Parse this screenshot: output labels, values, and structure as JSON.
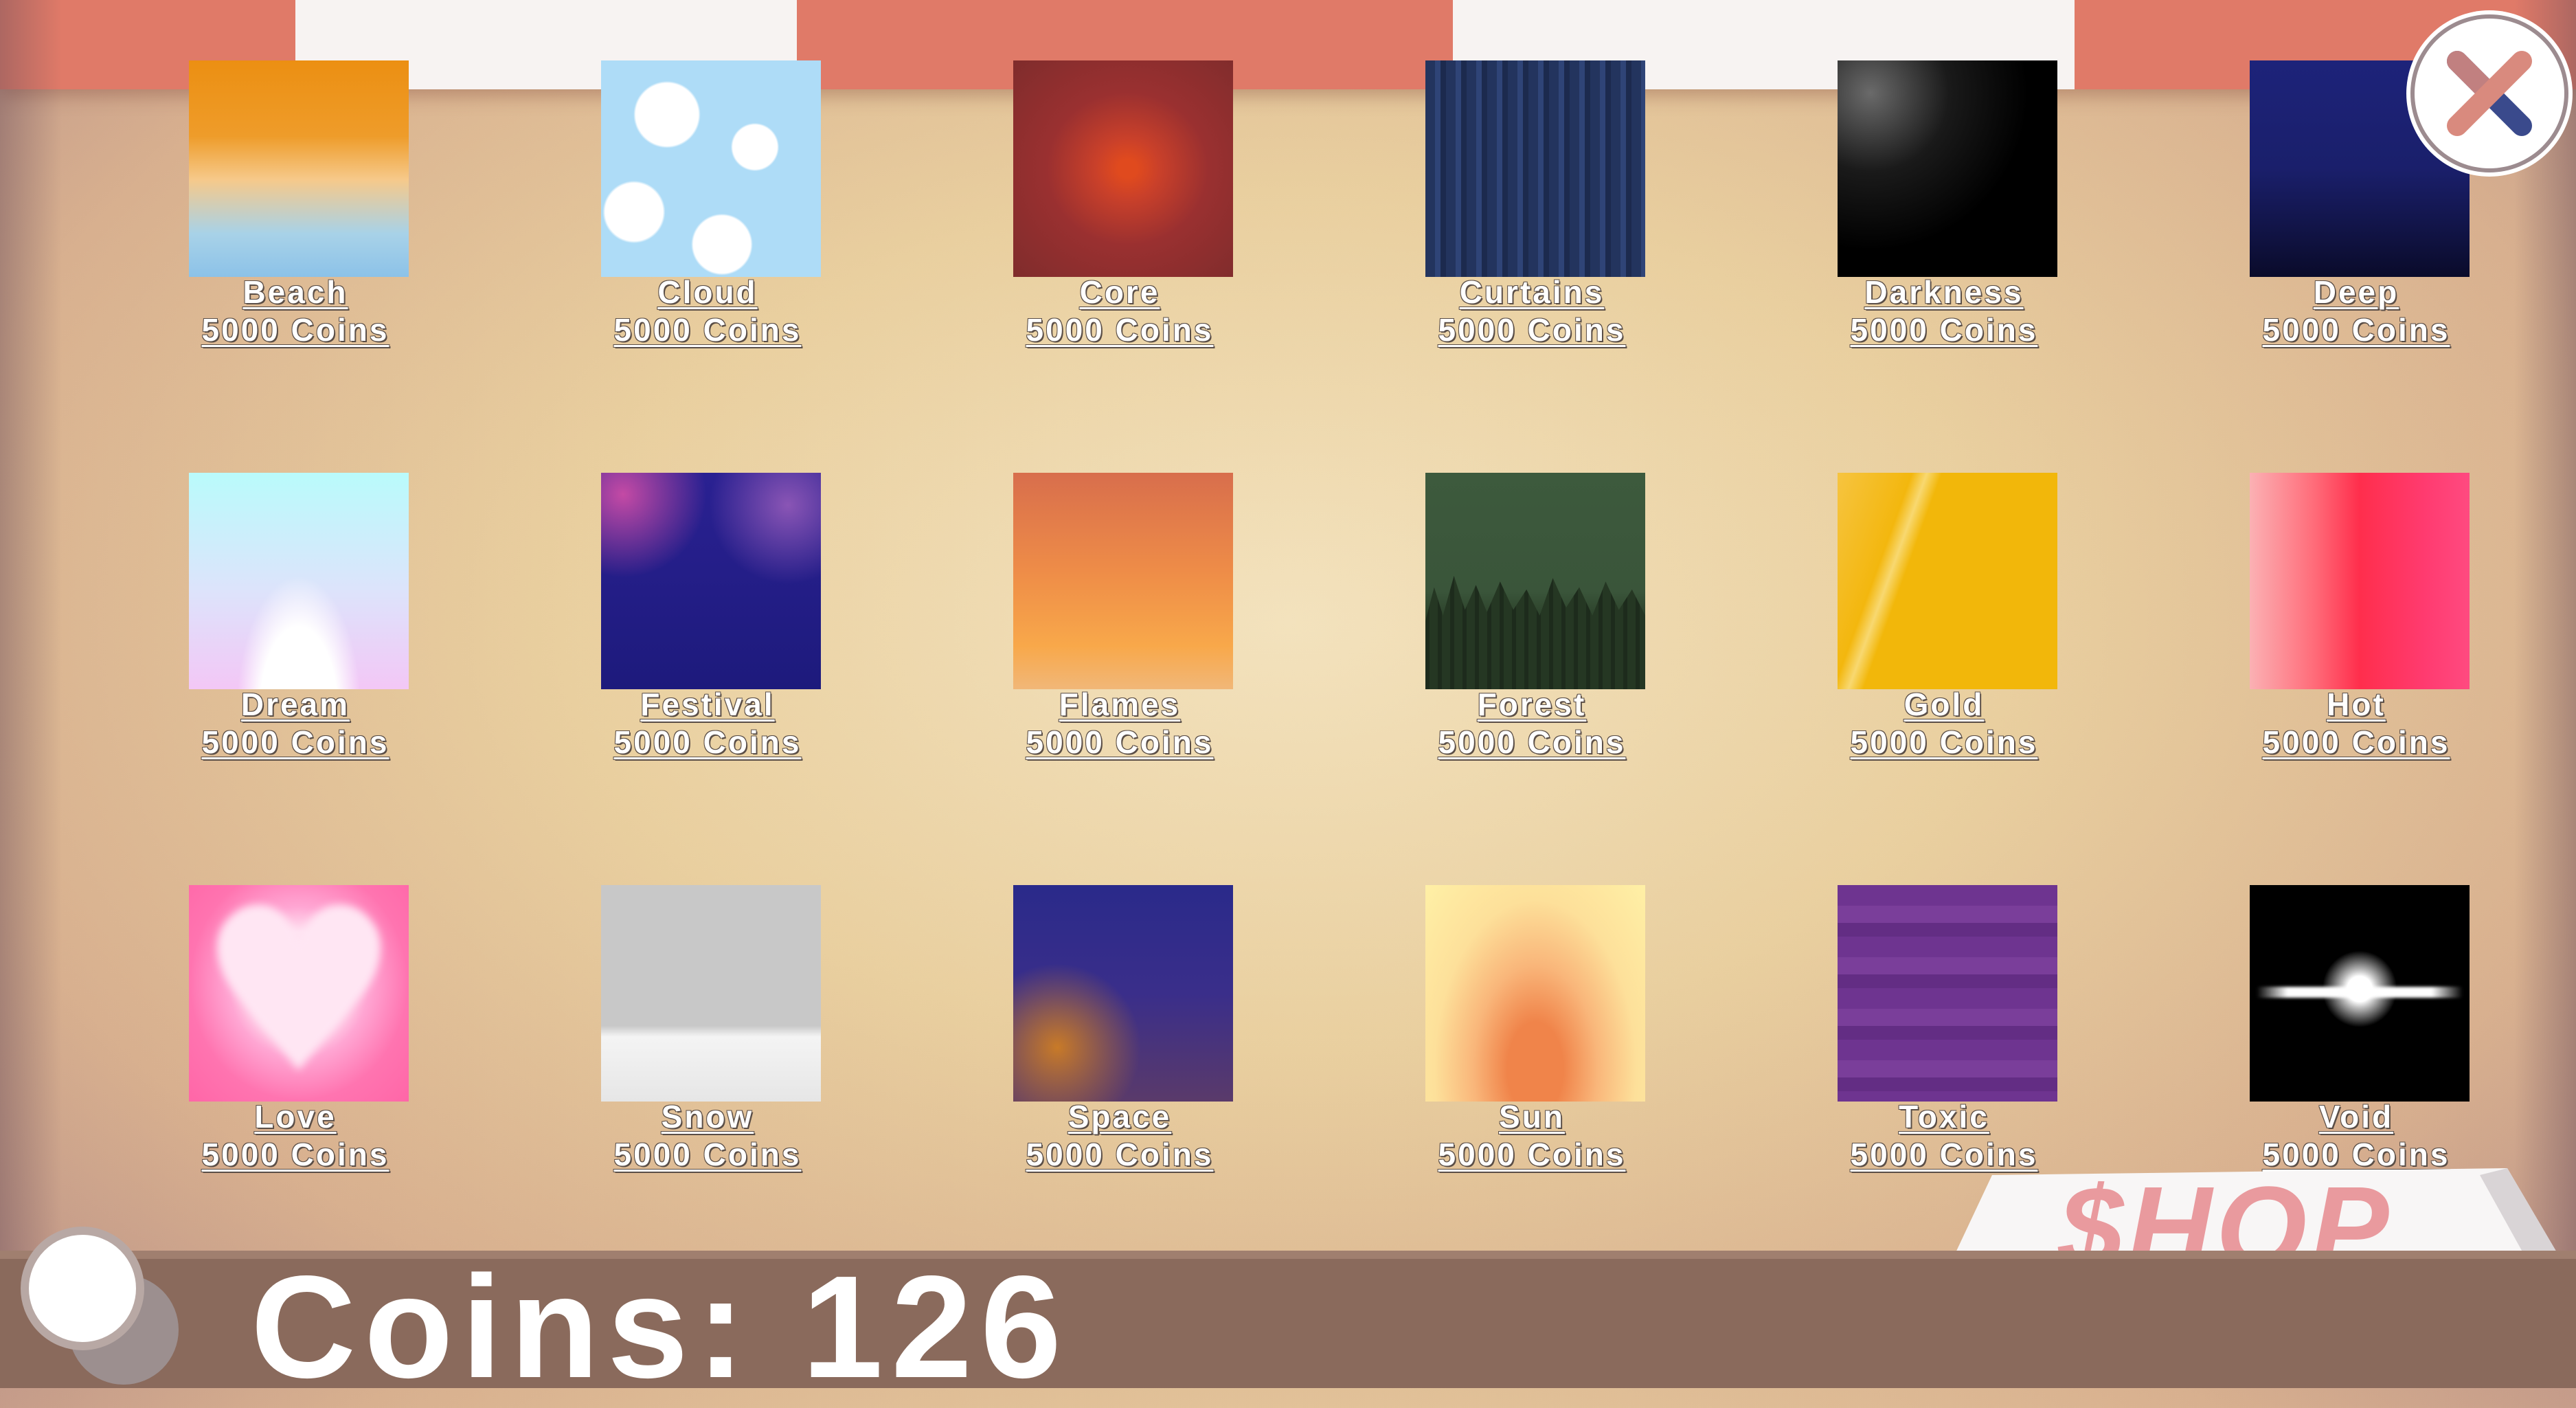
{
  "colors": {
    "awning_red": "#e07a68",
    "awning_white": "#f7f3f2",
    "label_text": "#ffffff",
    "counter_wood": "#8a6a5c",
    "sign_text": "#e99a9e"
  },
  "shop": {
    "items": [
      {
        "name": "Beach",
        "price": "5000 Coins",
        "swatch": "beach"
      },
      {
        "name": "Cloud",
        "price": "5000 Coins",
        "swatch": "cloud"
      },
      {
        "name": "Core",
        "price": "5000 Coins",
        "swatch": "core"
      },
      {
        "name": "Curtains",
        "price": "5000 Coins",
        "swatch": "curtains"
      },
      {
        "name": "Darkness",
        "price": "5000 Coins",
        "swatch": "darkness"
      },
      {
        "name": "Deep",
        "price": "5000 Coins",
        "swatch": "deep"
      },
      {
        "name": "Dream",
        "price": "5000 Coins",
        "swatch": "dream"
      },
      {
        "name": "Festival",
        "price": "5000 Coins",
        "swatch": "festival"
      },
      {
        "name": "Flames",
        "price": "5000 Coins",
        "swatch": "flames"
      },
      {
        "name": "Forest",
        "price": "5000 Coins",
        "swatch": "forest"
      },
      {
        "name": "Gold",
        "price": "5000 Coins",
        "swatch": "gold"
      },
      {
        "name": "Hot",
        "price": "5000 Coins",
        "swatch": "hot"
      },
      {
        "name": "Love",
        "price": "5000 Coins",
        "swatch": "love"
      },
      {
        "name": "Snow",
        "price": "5000 Coins",
        "swatch": "snow"
      },
      {
        "name": "Space",
        "price": "5000 Coins",
        "swatch": "space"
      },
      {
        "name": "Sun",
        "price": "5000 Coins",
        "swatch": "sun"
      },
      {
        "name": "Toxic",
        "price": "5000 Coins",
        "swatch": "toxic"
      },
      {
        "name": "Void",
        "price": "5000 Coins",
        "swatch": "void"
      }
    ],
    "coins_label": "Coins: 126",
    "sign_text": "$HOP",
    "close_icon": "close-x-icon",
    "coin_icon": "coin-icon"
  }
}
